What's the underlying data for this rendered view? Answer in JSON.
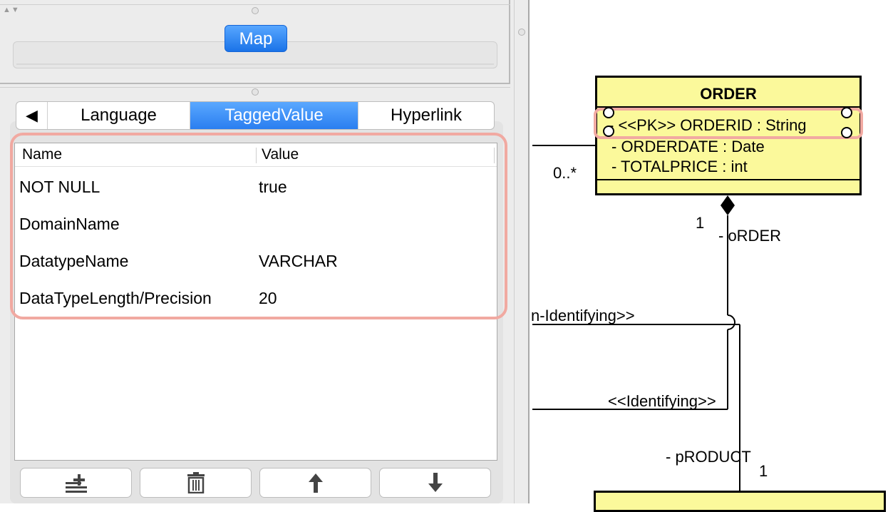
{
  "top_pane": {
    "map_button": "Map"
  },
  "tabs": {
    "back": "◀",
    "language": "Language",
    "tagged_value": "TaggedValue",
    "hyperlink": "Hyperlink"
  },
  "table": {
    "headers": [
      "Name",
      "Value"
    ],
    "rows": [
      {
        "name": "NOT NULL",
        "value": "true"
      },
      {
        "name": "DomainName",
        "value": ""
      },
      {
        "name": "DatatypeName",
        "value": "VARCHAR"
      },
      {
        "name": "DataTypeLength/Precision",
        "value": "20"
      }
    ]
  },
  "toolbar": {
    "icons": [
      "add-row-icon",
      "trash-icon",
      "arrow-up-icon",
      "arrow-down-icon"
    ]
  },
  "diagram": {
    "class_name": "ORDER",
    "attributes": [
      "- <<PK>> ORDERID : String",
      "- ORDERDATE : Date",
      "- TOTALPRICE : int"
    ],
    "mult_left": "0..*",
    "mult_top": "1",
    "role_order": "- oRDER",
    "stereo_nonident": "n-Identifying>>",
    "stereo_ident": "<<Identifying>>",
    "role_product": "- pRODUCT",
    "mult_bottom": "1"
  },
  "colors": {
    "accent_blue": "#2a7ef0",
    "class_fill": "#fbf99b",
    "highlight": "#f1a9a1"
  }
}
